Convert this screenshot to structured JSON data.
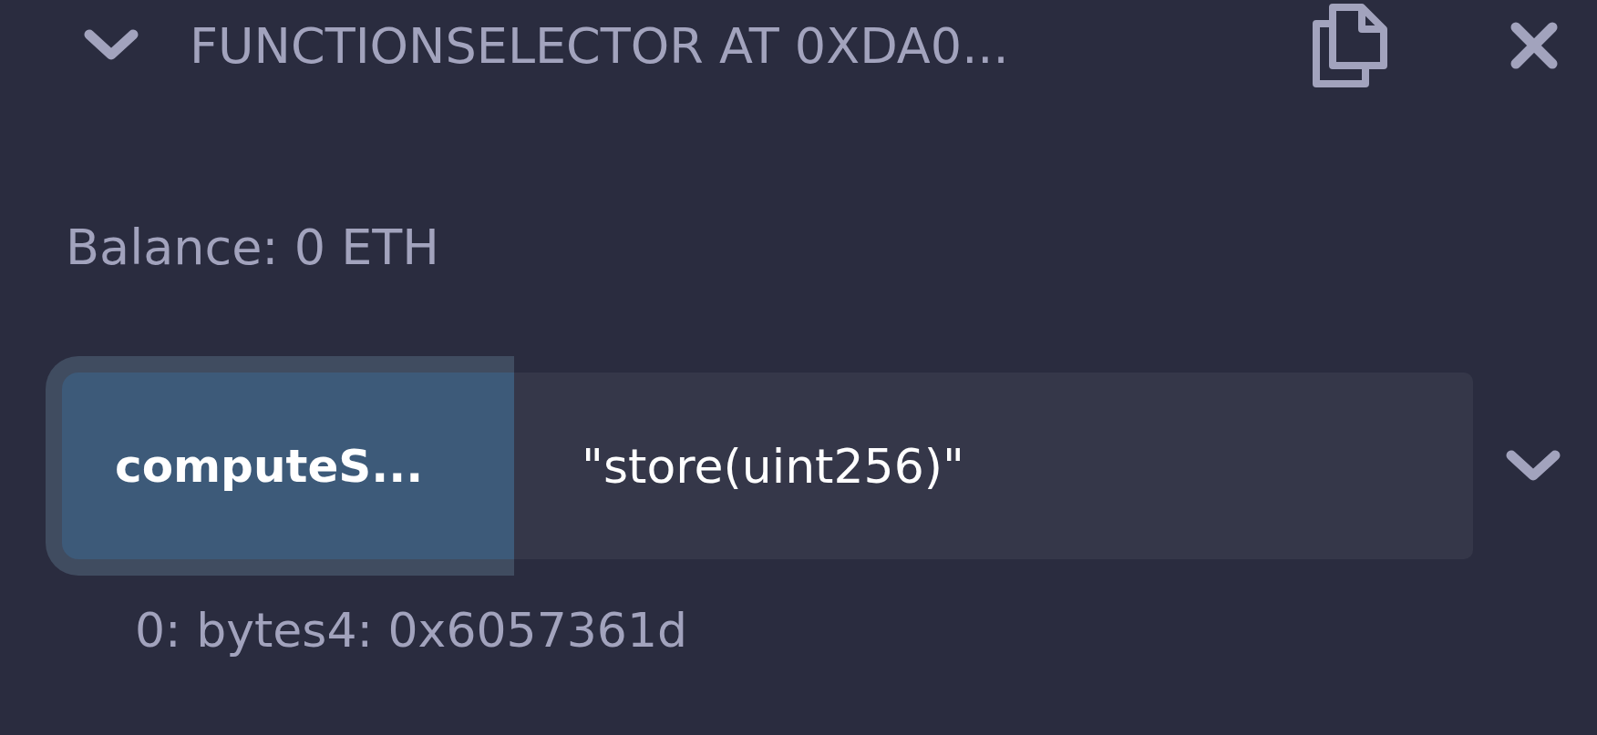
{
  "instance": {
    "title": "FUNCTIONSELECTOR AT 0XDA0...",
    "expanded": true
  },
  "balance": "Balance: 0 ETH",
  "function": {
    "button": "computeS...",
    "value": "\"store(uint256)\"",
    "expanded": false
  },
  "output": "0: bytes4: 0x6057361d"
}
